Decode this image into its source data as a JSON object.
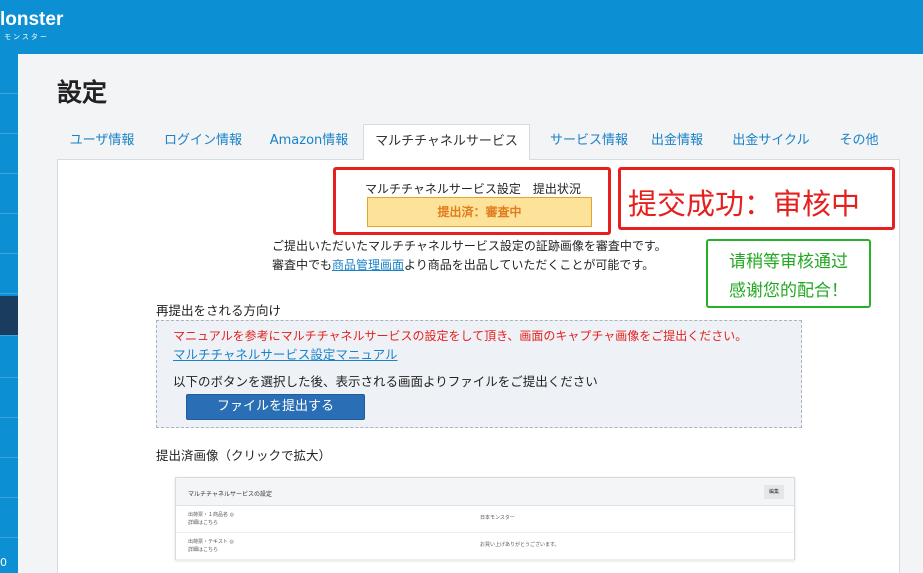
{
  "header": {
    "logo": "lonster",
    "logo_sub": "モンスター",
    "corner_number": "0"
  },
  "page": {
    "title": "設定"
  },
  "tabs": [
    {
      "label": "ユーザ情報"
    },
    {
      "label": "ログイン情報"
    },
    {
      "label": "Amazon情報"
    },
    {
      "label": "マルチチャネルサービス"
    },
    {
      "label": "サービス情報"
    },
    {
      "label": "出金情報"
    },
    {
      "label": "出金サイクル"
    },
    {
      "label": "その他"
    }
  ],
  "status": {
    "label": "マルチチャネルサービス設定　提出状況",
    "badge": "提出済：審査中"
  },
  "annotations": {
    "success": "提交成功：审核中",
    "note_line1": "请稍等审核通过",
    "note_line2": "感谢您的配合！"
  },
  "description": {
    "line1": "ご提出いただいたマルチチャネルサービス設定の証跡画像を審査中です。",
    "line2_prefix": "審査中でも",
    "line2_link": "商品管理画面",
    "line2_suffix": "より商品を出品していただくことが可能です。"
  },
  "resubmit": {
    "title": "再提出をされる方向け",
    "instruction_red": "マニュアルを参考にマルチチャネルサービスの設定をして頂き、画面のキャプチャ画像をご提出ください。",
    "manual_link": "マルチチャネルサービス設定マニュアル",
    "instruction": "以下のボタンを選択した後、表示される画面よりファイルをご提出ください",
    "button": "ファイルを提出する"
  },
  "submitted": {
    "title": "提出済画像（クリックで拡大）",
    "thumb_title": "マルチチャネルサービスの設定",
    "thumb_button": "編集",
    "rows": [
      {
        "left1": "出荷票・１商品名 ◎",
        "left2": "詳細はこちら",
        "right": "日本モンスター"
      },
      {
        "left1": "出荷票・テキスト ◎",
        "left2": "詳細はこちら",
        "right": "お買い上げありがとうございます。"
      }
    ]
  },
  "colors": {
    "brand_blue": "#0d8fd4",
    "alert_red": "#e5201f",
    "note_green": "#22a822",
    "badge_yellow": "#fde29a"
  }
}
